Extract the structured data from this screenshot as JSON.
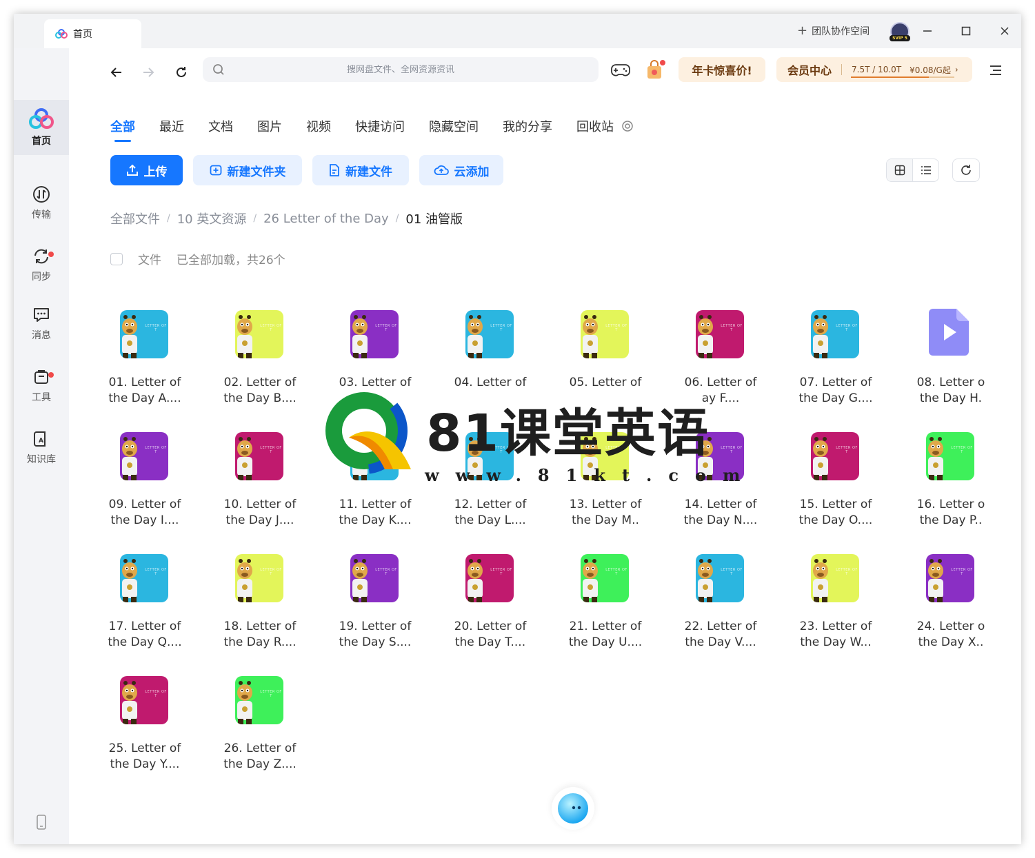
{
  "titlebar": {
    "tab_label": "首页",
    "team_space_label": "团队协作空间",
    "avatar_badge": "SVIP 5"
  },
  "sidebar": {
    "items": [
      {
        "label": "首页",
        "icon": "cloud-logo-icon",
        "active": true
      },
      {
        "label": "传输",
        "icon": "transfer-icon"
      },
      {
        "label": "同步",
        "icon": "sync-icon",
        "badge": true
      },
      {
        "label": "消息",
        "icon": "message-icon"
      },
      {
        "label": "工具",
        "icon": "toolbox-icon",
        "badge": true
      },
      {
        "label": "知识库",
        "icon": "knowledge-base-icon"
      }
    ]
  },
  "header": {
    "search_placeholder": "搜网盘文件、全网资源资讯",
    "promo_label": "年卡惊喜价!",
    "vip_label": "会员中心",
    "vip_quota": "7.5T / 10.0T",
    "vip_price": "¥0.08/G起",
    "quota_used_fraction": 0.75
  },
  "categories": [
    "全部",
    "最近",
    "文档",
    "图片",
    "视频",
    "快捷访问",
    "隐藏空间",
    "我的分享",
    "回收站"
  ],
  "actions": {
    "upload": "上传",
    "new_folder": "新建文件夹",
    "new_file": "新建文件",
    "cloud_add": "云添加"
  },
  "breadcrumb": [
    "全部文件",
    "10 英文资源",
    "26 Letter of the Day",
    "01 油管版"
  ],
  "list_header": {
    "file_label": "文件",
    "status": "已全部加载，共26个"
  },
  "thumb_label": "LETTER OF T",
  "files": [
    {
      "line1": "01. Letter of",
      "line2": "the Day A....",
      "color": "#2bb6e0"
    },
    {
      "line1": "02. Letter of",
      "line2": "the Day B....",
      "color": "#e3f55a"
    },
    {
      "line1": "03. Letter of",
      "line2": "",
      "color": "#8a2fc4"
    },
    {
      "line1": "04. Letter of",
      "line2": "",
      "color": "#2bb6e0"
    },
    {
      "line1": "05. Letter of",
      "line2": "",
      "color": "#e3f55a"
    },
    {
      "line1": "06. Letter of",
      "line2": "ay F....",
      "color": "#c01a6e"
    },
    {
      "line1": "07. Letter of",
      "line2": "the Day G....",
      "color": "#2bb6e0"
    },
    {
      "line1": "08. Letter o",
      "line2": "the Day H.",
      "color": "video"
    },
    {
      "line1": "09. Letter of",
      "line2": "the Day I....",
      "color": "#8a2fc4"
    },
    {
      "line1": "10. Letter of",
      "line2": "the Day J....",
      "color": "#c01a6e"
    },
    {
      "line1": "11. Letter of",
      "line2": "the Day K....",
      "color": "#2bb6e0"
    },
    {
      "line1": "12. Letter of",
      "line2": "the Day L....",
      "color": "#2bb6e0"
    },
    {
      "line1": "13. Letter of",
      "line2": "the Day M..",
      "color": "#e3f55a"
    },
    {
      "line1": "14. Letter of",
      "line2": "the Day N....",
      "color": "#8a2fc4"
    },
    {
      "line1": "15. Letter of",
      "line2": "the Day O....",
      "color": "#c01a6e"
    },
    {
      "line1": "16. Letter o",
      "line2": "the Day P..",
      "color": "#3ef05a"
    },
    {
      "line1": "17. Letter of",
      "line2": "the Day Q....",
      "color": "#2bb6e0"
    },
    {
      "line1": "18. Letter of",
      "line2": "the Day R....",
      "color": "#e3f55a"
    },
    {
      "line1": "19. Letter of",
      "line2": "the Day S....",
      "color": "#8a2fc4"
    },
    {
      "line1": "20. Letter of",
      "line2": "the Day T....",
      "color": "#c01a6e"
    },
    {
      "line1": "21. Letter of",
      "line2": "the Day U....",
      "color": "#3ef05a"
    },
    {
      "line1": "22. Letter of",
      "line2": "the Day V....",
      "color": "#2bb6e0"
    },
    {
      "line1": "23. Letter of",
      "line2": "the Day W...",
      "color": "#e3f55a"
    },
    {
      "line1": "24. Letter o",
      "line2": "the Day X..",
      "color": "#8a2fc4"
    },
    {
      "line1": "25. Letter of",
      "line2": "the Day Y....",
      "color": "#c01a6e"
    },
    {
      "line1": "26. Letter of",
      "line2": "the Day Z....",
      "color": "#3ef05a"
    }
  ],
  "watermark": {
    "title": "81课堂英语",
    "url": "www.81kt.com"
  }
}
